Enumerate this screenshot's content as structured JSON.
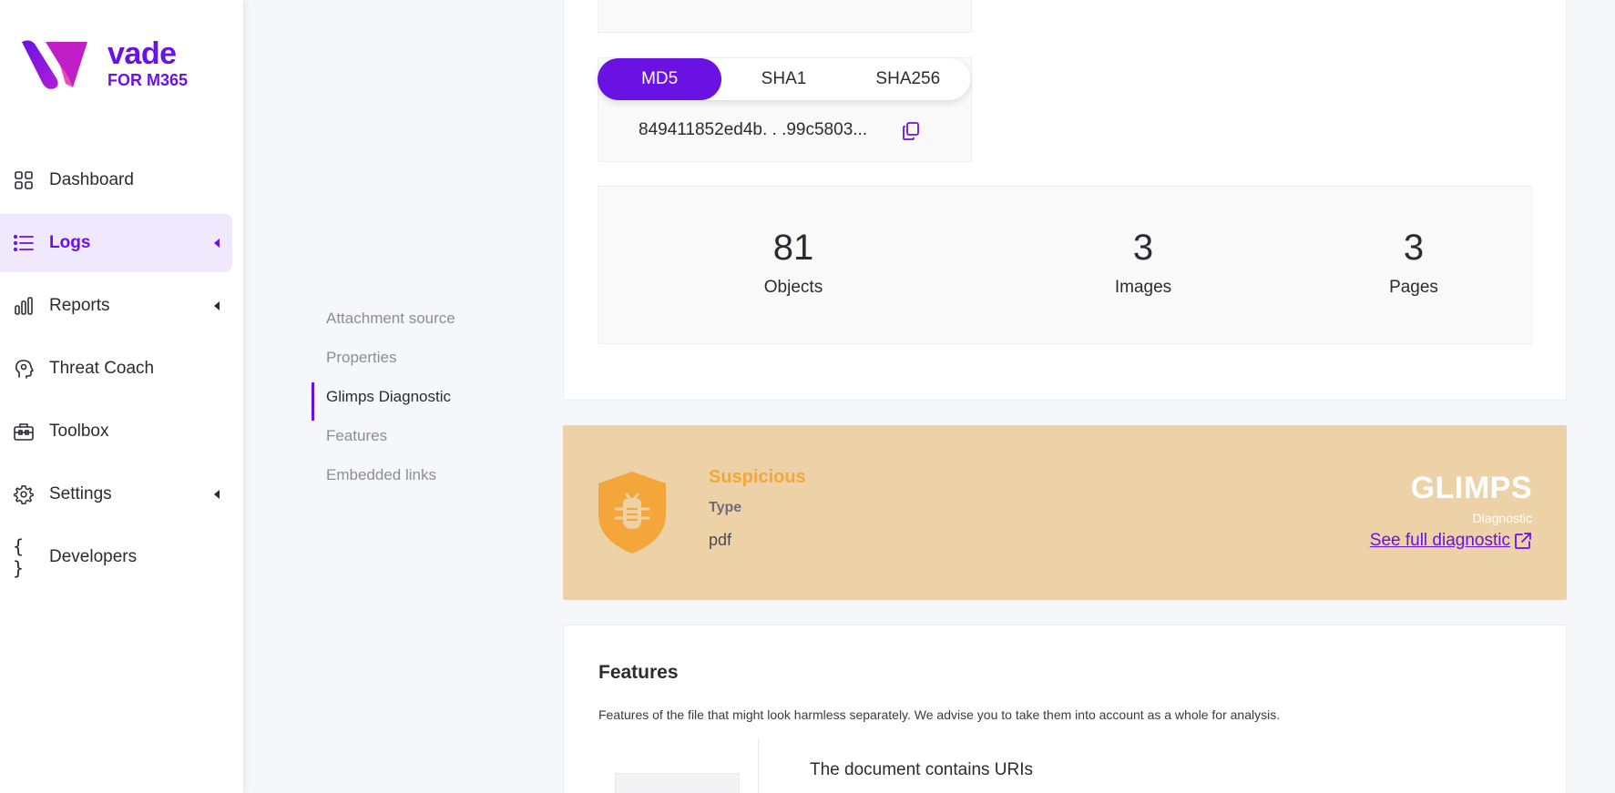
{
  "brand": {
    "name": "vade",
    "subtitle": "FOR M365",
    "accent_color": "#6a11e4"
  },
  "sidebar": {
    "items": [
      {
        "label": "Dashboard",
        "icon": "grid-icon",
        "active": false,
        "expandable": false
      },
      {
        "label": "Logs",
        "icon": "list-icon",
        "active": true,
        "expandable": true
      },
      {
        "label": "Reports",
        "icon": "bar-chart-icon",
        "active": false,
        "expandable": true
      },
      {
        "label": "Threat Coach",
        "icon": "head-icon",
        "active": false,
        "expandable": false
      },
      {
        "label": "Toolbox",
        "icon": "toolbox-icon",
        "active": false,
        "expandable": false
      },
      {
        "label": "Settings",
        "icon": "gear-icon",
        "active": false,
        "expandable": true
      },
      {
        "label": "Developers",
        "icon": "braces-icon",
        "active": false,
        "expandable": false
      }
    ]
  },
  "anchors": {
    "items": [
      {
        "label": "Attachment source",
        "active": false
      },
      {
        "label": "Properties",
        "active": false
      },
      {
        "label": "Glimps Diagnostic",
        "active": true
      },
      {
        "label": "Features",
        "active": false
      },
      {
        "label": "Embedded links",
        "active": false
      }
    ]
  },
  "hash": {
    "tabs": [
      "MD5",
      "SHA1",
      "SHA256"
    ],
    "selected": "MD5",
    "value": "849411852ed4b. . .99c5803..."
  },
  "stats": {
    "objects": {
      "value": "81",
      "label": "Objects"
    },
    "images": {
      "value": "3",
      "label": "Images"
    },
    "pages": {
      "value": "3",
      "label": "Pages"
    }
  },
  "glimps": {
    "verdict": "Suspicious",
    "verdict_color": "#f5a63a",
    "type_label": "Type",
    "type_value": "pdf",
    "logo": "GLIMPS",
    "logo_sub": "Diagnostic",
    "link": "See full diagnostic"
  },
  "features": {
    "title": "Features",
    "description": "Features of the file that might look harmless separately. We advise you to take them into account as a whole for analysis.",
    "first_item": "The document contains URIs"
  }
}
